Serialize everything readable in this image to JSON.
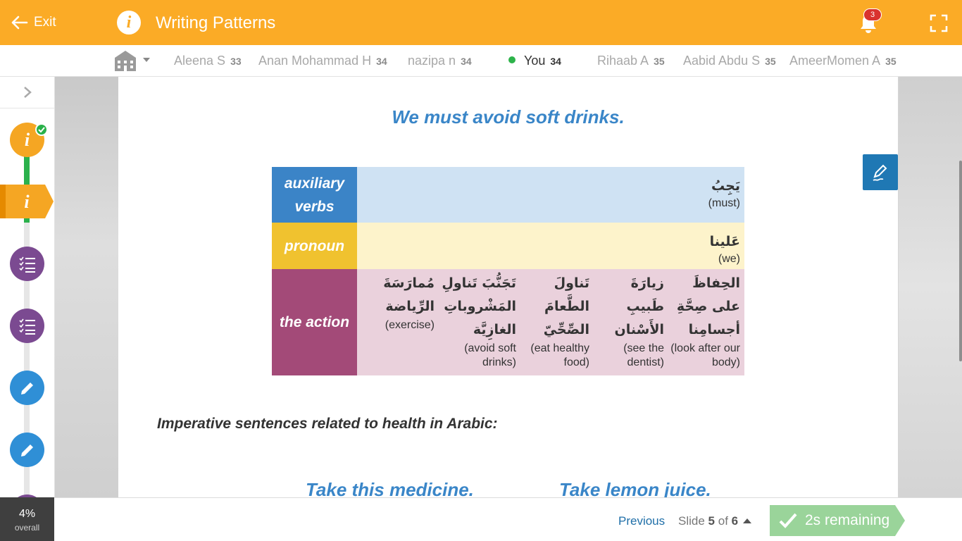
{
  "header": {
    "exit_label": "Exit",
    "title": "Writing Patterns",
    "notification_count": "3"
  },
  "leaderboard": [
    {
      "name": "Aleena S",
      "score": "33"
    },
    {
      "name": "Anan Mohammad H",
      "score": "34"
    },
    {
      "name": "nazipa n",
      "score": "34"
    },
    {
      "name": "You",
      "score": "34",
      "current_user": true
    },
    {
      "name": "Rihaab A",
      "score": "35"
    },
    {
      "name": "Aabid Abdu S",
      "score": "35"
    },
    {
      "name": "AmeerMomen A",
      "score": "35"
    }
  ],
  "slide": {
    "heading": "We must avoid soft drinks.",
    "table": {
      "aux": {
        "label": "auxiliary verbs",
        "arabic": "يَجِبُ",
        "english": "(must)"
      },
      "pronoun": {
        "label": "pronoun",
        "arabic": "عَلينا",
        "english": "(we)"
      },
      "action": {
        "label": "the action",
        "items": [
          {
            "arabic": "الحِفاظَ على صِحَّةِ أجسامِنا",
            "english": "(look after our body)"
          },
          {
            "arabic": "زيارَةَ طَبيبِ الأَسْنان",
            "english": "(see the dentist)"
          },
          {
            "arabic": "تَناولَ الطَّعامَ الصِّحِّيّ",
            "english": "(eat healthy food)"
          },
          {
            "arabic": "تَجَنُّبَ تَناولِ المَشْروباتِ الغازِيَّة",
            "english": "(avoid soft drinks)"
          },
          {
            "arabic": "مُمارَسَةَ الرِّياضة",
            "english": "(exercise)"
          }
        ]
      }
    },
    "imperative_heading": "Imperative sentences related to health in Arabic:",
    "examples": [
      "Take this medicine.",
      "Take lemon juice."
    ]
  },
  "sidebar": {
    "overall_percent": "4%",
    "overall_label": "overall"
  },
  "footer": {
    "previous_label": "Previous",
    "slide_prefix": "Slide",
    "slide_current": "5",
    "slide_of": "of",
    "slide_total": "6",
    "remaining_label": "2s remaining"
  },
  "colors": {
    "brand_orange": "#fbab26",
    "aux_blue": "#3b84c7",
    "pronoun_yellow": "#f0c22f",
    "action_purple": "#a34a78",
    "heading_blue": "#3a86c8",
    "remaining_green": "#9ad49a"
  }
}
